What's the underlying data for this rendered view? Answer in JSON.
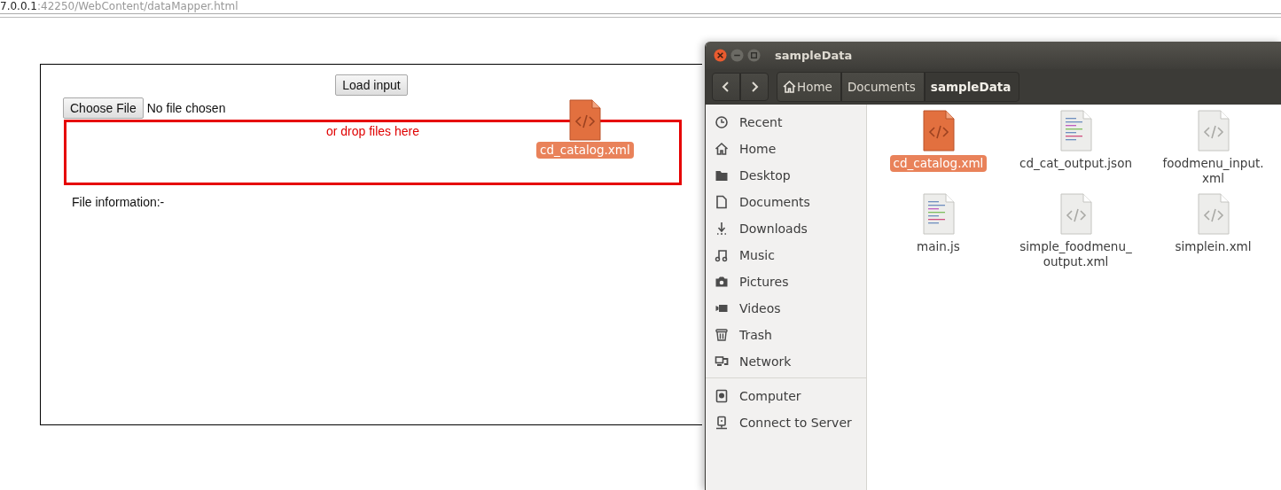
{
  "address_bar": {
    "host": "7.0.0.1",
    "path": ":42250/WebContent/dataMapper.html"
  },
  "page": {
    "load_button": "Load input",
    "choose_button": "Choose File",
    "file_status": "No file chosen",
    "drop_hint": "or drop files here",
    "file_info": "File information:-",
    "drag_item": {
      "name": "cd_catalog.xml",
      "kind": "code",
      "selected": true
    }
  },
  "file_window": {
    "title": "sampleData",
    "breadcrumbs": [
      {
        "label": "Home",
        "selected": false
      },
      {
        "label": "Documents",
        "selected": false
      },
      {
        "label": "sampleData",
        "selected": true
      }
    ],
    "sidebar": {
      "sections": [
        {
          "items": [
            {
              "label": "Recent"
            },
            {
              "label": "Home"
            },
            {
              "label": "Desktop"
            },
            {
              "label": "Documents"
            },
            {
              "label": "Downloads"
            },
            {
              "label": "Music"
            },
            {
              "label": "Pictures"
            },
            {
              "label": "Videos"
            },
            {
              "label": "Trash"
            },
            {
              "label": "Network"
            }
          ]
        },
        {
          "items": [
            {
              "label": "Computer"
            },
            {
              "label": "Connect to Server"
            }
          ]
        }
      ]
    },
    "files": [
      {
        "name": "cd_catalog.xml",
        "kind": "code",
        "selected": true
      },
      {
        "name": "cd_cat_output.json",
        "kind": "text",
        "selected": false
      },
      {
        "name": "foodmenu_input.\nxml",
        "kind": "code",
        "selected": false
      },
      {
        "name": "main.js",
        "kind": "text",
        "selected": false
      },
      {
        "name": "simple_foodmenu_\noutput.xml",
        "kind": "code",
        "selected": false
      },
      {
        "name": "simplein.xml",
        "kind": "code",
        "selected": false
      }
    ]
  }
}
